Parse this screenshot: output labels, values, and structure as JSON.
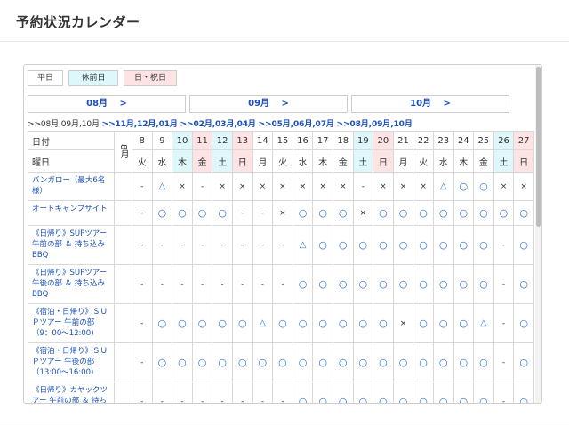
{
  "page": {
    "title": "予約状況カレンダー"
  },
  "legend": {
    "weekday": "平日",
    "pre_holiday": "休前日",
    "sun_holiday": "日・祝日"
  },
  "months": [
    "08月 　>",
    "09月 　>",
    "10月 　>"
  ],
  "pager": [
    {
      "text": ">>08月,09月,10月",
      "current": true
    },
    {
      "text": ">>11月,12月,01月",
      "current": false
    },
    {
      "text": ">>02月,03月,04月",
      "current": false
    },
    {
      "text": ">>05月,06月,07月",
      "current": false
    },
    {
      "text": ">>08月,09月,10月",
      "current": false
    }
  ],
  "table": {
    "date_label": "日付",
    "day_label": "曜日",
    "month_label": "8月",
    "dates": [
      "8",
      "9",
      "10",
      "11",
      "12",
      "13",
      "14",
      "15",
      "16",
      "17",
      "18",
      "19",
      "20",
      "21",
      "22",
      "23",
      "24",
      "25",
      "26",
      "27"
    ],
    "days": [
      "火",
      "水",
      "木",
      "金",
      "土",
      "日",
      "月",
      "火",
      "水",
      "木",
      "金",
      "土",
      "日",
      "月",
      "火",
      "水",
      "木",
      "金",
      "土",
      "日"
    ],
    "date_bg": [
      "",
      "",
      "blue",
      "pink",
      "blue",
      "pink",
      "",
      "",
      "",
      "",
      "",
      "blue",
      "pink",
      "",
      "",
      "",
      "",
      "",
      "blue",
      "pink"
    ],
    "rows": [
      {
        "label": "バンガロー（最大6名様）",
        "cells": [
          "-",
          "△",
          "×",
          "-",
          "×",
          "×",
          "×",
          "×",
          "×",
          "×",
          "×",
          "-",
          "×",
          "×",
          "×",
          "△",
          "○",
          "○",
          "×",
          "×"
        ]
      },
      {
        "label": "オートキャンプサイト",
        "cells": [
          "-",
          "○",
          "○",
          "○",
          "○",
          "-",
          "-",
          "×",
          "○",
          "○",
          "○",
          "×",
          "○",
          "○",
          "○",
          "○",
          "○",
          "○",
          "○",
          "○"
        ]
      },
      {
        "label": "《日帰り》SUPツアー 午前の部 ＆ 持ち込みBBQ",
        "cells": [
          "-",
          "-",
          "-",
          "-",
          "-",
          "-",
          "-",
          "-",
          "△",
          "○",
          "○",
          "○",
          "○",
          "○",
          "○",
          "○",
          "○",
          "○",
          "-",
          "○"
        ]
      },
      {
        "label": "《日帰り》SUPツアー 午後の部 ＆ 持ち込みBBQ",
        "cells": [
          "-",
          "-",
          "-",
          "-",
          "-",
          "-",
          "-",
          "-",
          "○",
          "○",
          "○",
          "○",
          "○",
          "○",
          "○",
          "○",
          "○",
          "○",
          "-",
          "○"
        ]
      },
      {
        "label": "《宿泊・日帰り》ＳＵＰツアー 午前の部 （9：00〜12:00)",
        "cells": [
          "-",
          "○",
          "○",
          "○",
          "○",
          "○",
          "△",
          "○",
          "○",
          "○",
          "○",
          "○",
          "○",
          "×",
          "○",
          "○",
          "○",
          "△",
          "-",
          "○"
        ]
      },
      {
        "label": "《宿泊・日帰り》ＳＵＰツアー 午後の部 （13:00〜16:00)",
        "cells": [
          "-",
          "○",
          "○",
          "○",
          "○",
          "○",
          "○",
          "○",
          "○",
          "○",
          "○",
          "○",
          "○",
          "○",
          "○",
          "○",
          "○",
          "○",
          "-",
          "○"
        ]
      },
      {
        "label": "《日帰り》カヤックツアー 午前の部 ＆ 持ち込みBBQ",
        "cells": [
          "-",
          "-",
          "-",
          "-",
          "-",
          "-",
          "-",
          "-",
          "○",
          "○",
          "○",
          "○",
          "○",
          "○",
          "○",
          "○",
          "○",
          "○",
          "-",
          "○"
        ]
      }
    ]
  }
}
